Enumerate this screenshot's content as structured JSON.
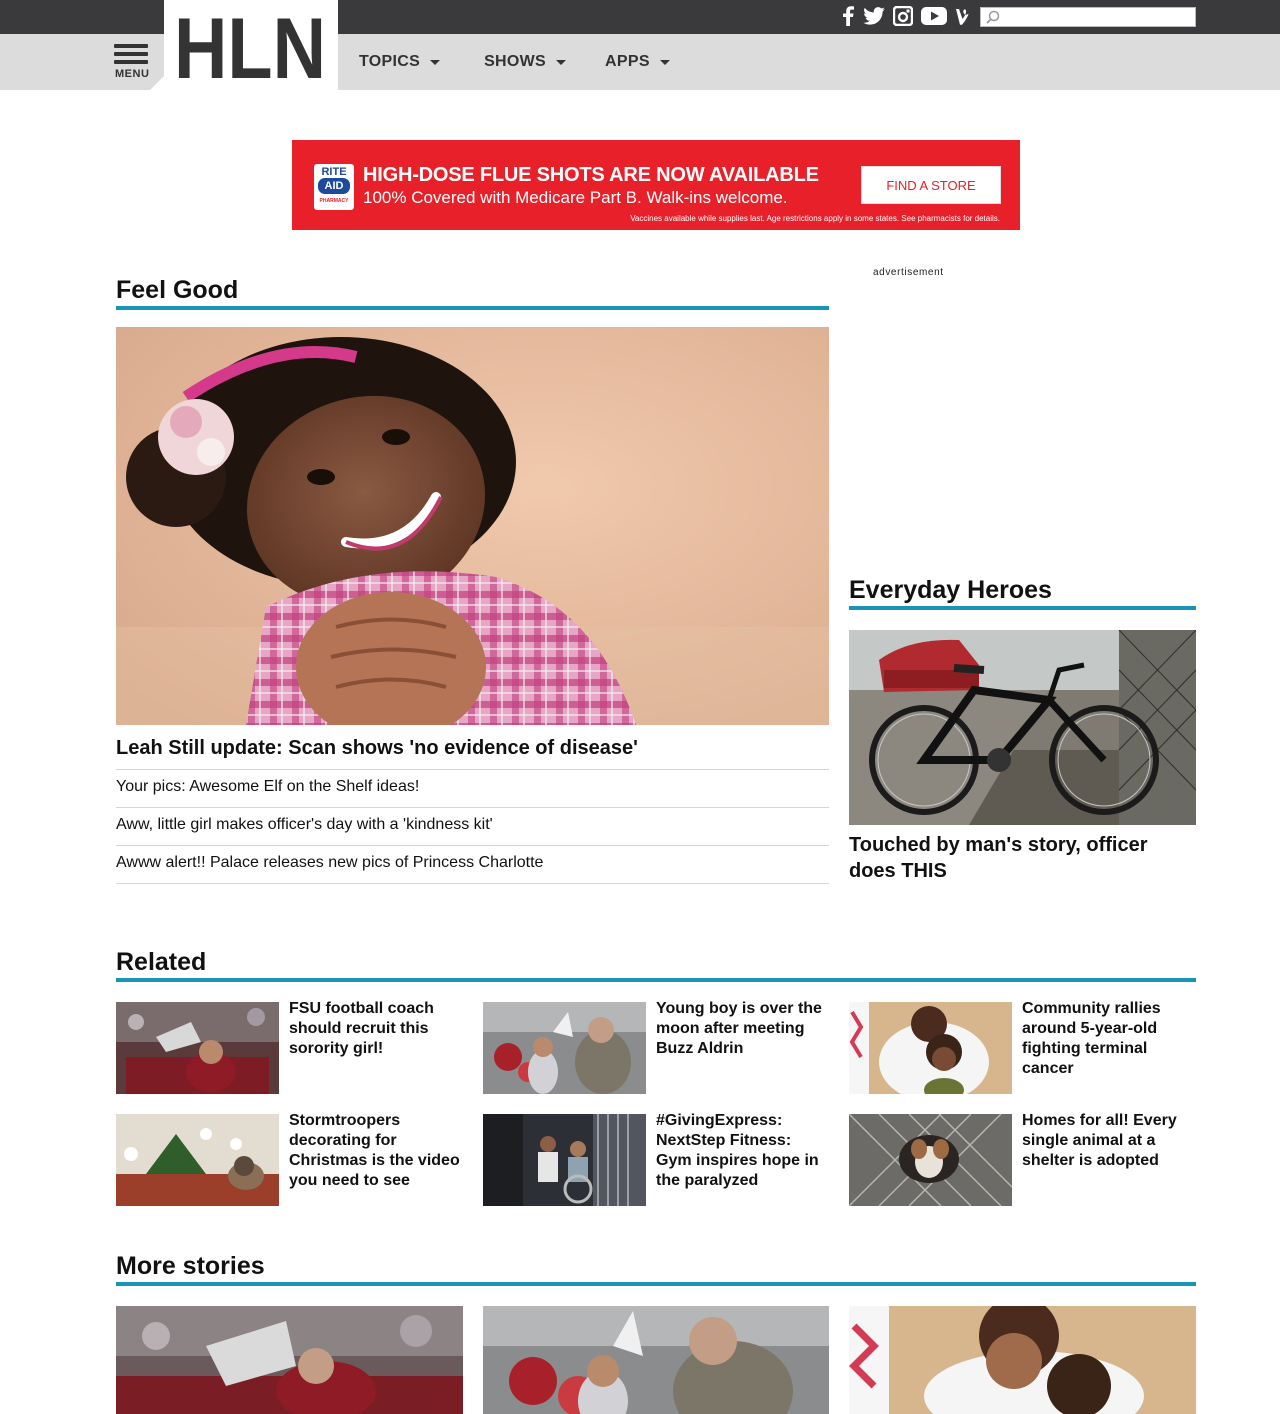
{
  "header": {
    "logo_text": "HLN",
    "menu_label": "MENU",
    "nav": [
      {
        "label": "TOPICS"
      },
      {
        "label": "SHOWS"
      },
      {
        "label": "APPS"
      }
    ],
    "social_icons": [
      "facebook-icon",
      "twitter-icon",
      "instagram-icon",
      "youtube-icon",
      "vine-icon"
    ],
    "search_placeholder": ""
  },
  "ad_banner": {
    "brand_line1": "RITE",
    "brand_line2": "AID",
    "brand_line3": "PHARMACY",
    "headline": "HIGH-DOSE FLUE SHOTS ARE NOW AVAILABLE",
    "subline": "100% Covered with Medicare Part B. Walk-ins welcome.",
    "fine_print": "Vaccines available while supplies last. Age restrictions apply in some states. See pharmacists for details.",
    "cta": "FIND A STORE"
  },
  "advertisement_label": "advertisement",
  "feel_good": {
    "title": "Feel Good",
    "headline": "Leah Still update: Scan shows 'no evidence of disease'",
    "items": [
      "Your pics: Awesome Elf on the Shelf ideas!",
      "Aww, little girl makes officer's day with a 'kindness kit'",
      "Awww alert!! Palace releases new pics of Princess Charlotte"
    ]
  },
  "everyday_heroes": {
    "title": "Everyday Heroes",
    "headline": "Touched by man's story, officer does THIS"
  },
  "related": {
    "title": "Related",
    "items": [
      {
        "text": "FSU football coach should recruit this sorority girl!"
      },
      {
        "text": "Young boy is over the moon after meeting Buzz Aldrin"
      },
      {
        "text": "Community rallies around 5-year-old fighting terminal cancer"
      },
      {
        "text": "Stormtroopers decorating for Christmas is the video you need to see"
      },
      {
        "text": "#GivingExpress: NextStep Fitness: Gym inspires hope in the paralyzed"
      },
      {
        "text": "Homes for all! Every single animal at a shelter is adopted"
      }
    ]
  },
  "more_stories": {
    "title": "More stories"
  },
  "colors": {
    "accent_rule": "#1a93b6",
    "topbar": "#3a3a3c",
    "navbar": "#dcdcdc",
    "ad_red": "#e8202a"
  }
}
